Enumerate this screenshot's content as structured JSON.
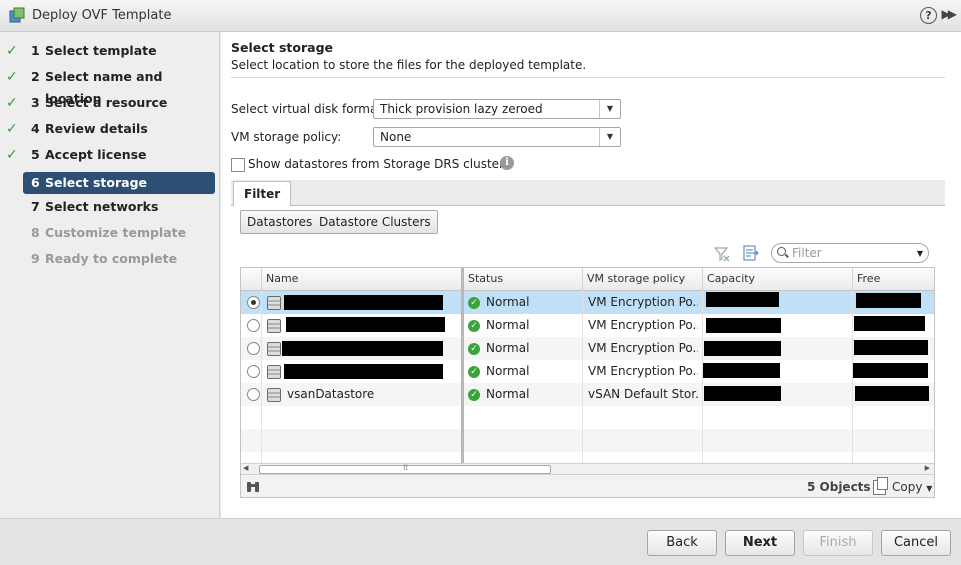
{
  "window": {
    "title": "Deploy OVF Template",
    "help_label": "?",
    "expand_label": "▶▶"
  },
  "steps": [
    {
      "num": "1",
      "label": "Select template",
      "state": "done"
    },
    {
      "num": "2",
      "label": "Select name and location",
      "state": "done"
    },
    {
      "num": "3",
      "label": "Select a resource",
      "state": "done"
    },
    {
      "num": "4",
      "label": "Review details",
      "state": "done"
    },
    {
      "num": "5",
      "label": "Accept license agreements",
      "state": "done"
    },
    {
      "num": "6",
      "label": "Select storage",
      "state": "active"
    },
    {
      "num": "7",
      "label": "Select networks",
      "state": "pending"
    },
    {
      "num": "8",
      "label": "Customize template",
      "state": "future"
    },
    {
      "num": "9",
      "label": "Ready to complete",
      "state": "future"
    }
  ],
  "page": {
    "title": "Select storage",
    "subtitle": "Select location to store the files for the deployed template."
  },
  "form": {
    "disk_format_label": "Select virtual disk format:",
    "disk_format_value": "Thick provision lazy zeroed",
    "policy_label": "VM storage policy:",
    "policy_value": "None",
    "show_drs_label": "Show datastores from Storage DRS clusters",
    "show_drs_checked": false
  },
  "tabs": {
    "filter": "Filter"
  },
  "segments": {
    "datastores": "Datastores",
    "datastore_clusters": "Datastore Clusters"
  },
  "filter": {
    "placeholder": "Filter"
  },
  "table": {
    "columns": [
      "Name",
      "Status",
      "VM storage policy",
      "Capacity",
      "Free"
    ],
    "rows": [
      {
        "selected": true,
        "name": "",
        "status": "Normal",
        "policy": "VM Encryption Po...",
        "capacity": "",
        "free": ""
      },
      {
        "selected": false,
        "name": "",
        "status": "Normal",
        "policy": "VM Encryption Po...",
        "capacity": "",
        "free": ""
      },
      {
        "selected": false,
        "name": "",
        "status": "Normal",
        "policy": "VM Encryption Po...",
        "capacity": "",
        "free": ""
      },
      {
        "selected": false,
        "name": "",
        "status": "Normal",
        "policy": "VM Encryption Po...",
        "capacity": "",
        "free": ""
      },
      {
        "selected": false,
        "name": "vsanDatastore",
        "status": "Normal",
        "policy": "vSAN Default Stor...",
        "capacity": "",
        "free": ""
      }
    ],
    "object_count": "5 Objects",
    "copy_label": "Copy"
  },
  "buttons": {
    "back": "Back",
    "next": "Next",
    "finish": "Finish",
    "cancel": "Cancel"
  },
  "colors": {
    "active_step": "#2d4f74",
    "check": "#3c9a3c",
    "selected_row": "#bfe0f7",
    "status_ok": "#3aa43a"
  }
}
